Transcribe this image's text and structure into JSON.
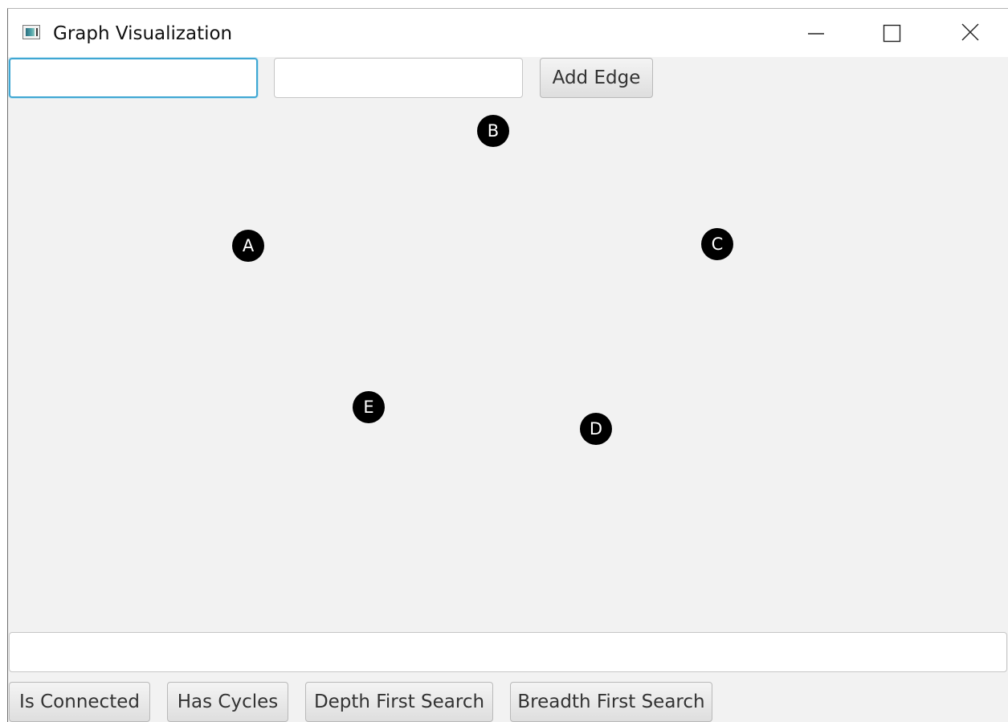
{
  "window": {
    "title": "Graph Visualization",
    "icons": {
      "app": "app-window-icon",
      "minimize": "minimize-icon",
      "maximize": "maximize-icon",
      "close": "close-icon"
    }
  },
  "toolbar": {
    "from_vertex": {
      "value": "",
      "placeholder": ""
    },
    "to_vertex": {
      "value": "",
      "placeholder": ""
    },
    "add_edge_label": "Add Edge"
  },
  "graph": {
    "nodes": [
      {
        "id": "A",
        "label": "A"
      },
      {
        "id": "B",
        "label": "B"
      },
      {
        "id": "C",
        "label": "C"
      },
      {
        "id": "D",
        "label": "D"
      },
      {
        "id": "E",
        "label": "E"
      }
    ],
    "edges": []
  },
  "output": {
    "value": "",
    "placeholder": ""
  },
  "actions": {
    "is_connected": "Is Connected",
    "has_cycles": "Has Cycles",
    "depth_first_search": "Depth First Search",
    "breadth_first_search": "Breadth First Search"
  },
  "colors": {
    "background": "#f2f2f2",
    "node_fill": "#000000",
    "node_text": "#ffffff",
    "focus_border": "#3fa7d3"
  }
}
